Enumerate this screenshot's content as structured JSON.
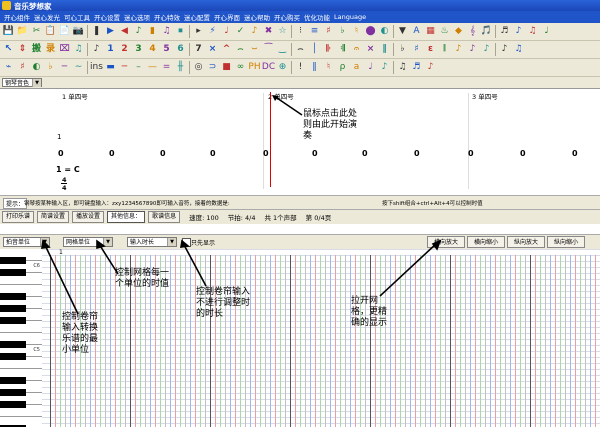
{
  "window": {
    "title": "音乐梦想家"
  },
  "menu": [
    "开心组件",
    "迷心发光",
    "可心工具",
    "开心设置",
    "迷心选项",
    "开心特效",
    "迷心配置",
    "开心界面",
    "迷心帮助",
    "开心购买",
    "优化功能",
    "Language"
  ],
  "toolbar": {
    "row1": [
      "💾",
      "📁",
      "✂",
      "📋",
      "📄",
      "📷",
      "❚",
      "▶",
      "◀",
      "♪",
      "▮",
      "♫",
      "⏹",
      "▸",
      "⚡",
      "♩",
      "✓",
      "♪",
      "✖",
      "☆",
      "⁝",
      "≡",
      "♯",
      "♭",
      "♮",
      "⬤",
      "◐",
      "▼",
      "A",
      "▦",
      "♨",
      "◆",
      "𝄞",
      "🎵",
      "♬",
      "♪",
      "♫",
      "♩"
    ],
    "row2": [
      "↖",
      "⇕",
      "搬",
      "录",
      "⌧",
      "♫",
      "♪",
      "1",
      "2",
      "3",
      "4",
      "5",
      "6",
      "7",
      "×",
      "^",
      "⌢",
      "⌣",
      "⁀",
      "‿",
      "⌢",
      "│",
      "𝄆",
      "𝄇",
      "𝄐",
      "×",
      "‖",
      "♭",
      "♯",
      "ɛ",
      "𝄁",
      "♪",
      "♪",
      "♪",
      "♪",
      "♫"
    ],
    "row3": [
      "⌁",
      "♯",
      "◐",
      "♭",
      "─",
      "∼",
      "ins",
      "▬",
      "─",
      "–",
      "—",
      "=",
      "╫",
      "◎",
      "⊃",
      "■",
      "∞",
      "PH",
      "DC",
      "⊕",
      "!",
      "‖",
      "♮",
      "ρ",
      "a",
      "♩",
      "♪",
      "♫",
      "♬",
      "♪"
    ],
    "instrument": "钢琴音色"
  },
  "score": {
    "measure_labels": [
      "1 单四号",
      "2 单四号",
      "3 单四号"
    ],
    "zeros": [
      "0",
      "0",
      "0",
      "0",
      "0",
      "0",
      "0",
      "0",
      "0",
      "0",
      "0",
      "0"
    ],
    "key": "1 = C",
    "time_top": "4",
    "time_bottom": "4",
    "voice_num": "1",
    "score_annotation": "鼠标点击此处则由此开始演奏",
    "lyric_hint": "提示"
  },
  "status": {
    "left_label": "提示：",
    "left_text": "钢琴按某种输入区，即可键盘输入：zxy1234567890即可输入音符，接着的数据是:",
    "right_text": "按下shift组合+ctrl+Alt+4可以控制时值"
  },
  "tabs": [
    {
      "label": "打印乐谱",
      "active": false
    },
    {
      "label": "简谱设置",
      "active": false
    },
    {
      "label": "播放设置",
      "active": false
    },
    {
      "label": "其他信息：",
      "active": true
    },
    {
      "label": "歌谱信息",
      "active": false
    }
  ],
  "status_values": {
    "speed": "速度: 100",
    "beat": "节拍: 4/4",
    "tracks": "共 1个声部",
    "sel": "第 0/4页"
  },
  "piano_toolbar": {
    "sel1": "拍音单位",
    "sel2": "网格单位",
    "sel3": "输入时长",
    "check_label": "只先显示",
    "buttons": [
      "横向放大",
      "横向缩小",
      "纵向放大",
      "纵向缩小"
    ]
  },
  "piano": {
    "grid_number": "1",
    "key_labels": [
      "C6",
      "C5",
      "C4"
    ]
  },
  "annotations": {
    "a1": "控制卷帘输入转换乐谱的最小单位",
    "a2": "控制网格每一个单位的时值",
    "a3": "控制卷帘输入不进行调整时的时长",
    "a4": "拉开网格，更精确的显示"
  }
}
